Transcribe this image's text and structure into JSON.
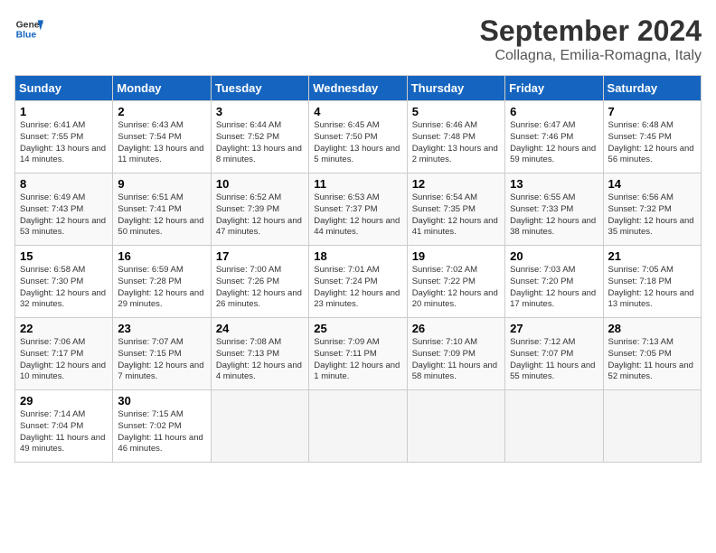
{
  "header": {
    "logo_general": "General",
    "logo_blue": "Blue",
    "month": "September 2024",
    "location": "Collagna, Emilia-Romagna, Italy"
  },
  "weekdays": [
    "Sunday",
    "Monday",
    "Tuesday",
    "Wednesday",
    "Thursday",
    "Friday",
    "Saturday"
  ],
  "weeks": [
    [
      {
        "day": "1",
        "sunrise": "6:41 AM",
        "sunset": "7:55 PM",
        "daylight": "13 hours and 14 minutes."
      },
      {
        "day": "2",
        "sunrise": "6:43 AM",
        "sunset": "7:54 PM",
        "daylight": "13 hours and 11 minutes."
      },
      {
        "day": "3",
        "sunrise": "6:44 AM",
        "sunset": "7:52 PM",
        "daylight": "13 hours and 8 minutes."
      },
      {
        "day": "4",
        "sunrise": "6:45 AM",
        "sunset": "7:50 PM",
        "daylight": "13 hours and 5 minutes."
      },
      {
        "day": "5",
        "sunrise": "6:46 AM",
        "sunset": "7:48 PM",
        "daylight": "13 hours and 2 minutes."
      },
      {
        "day": "6",
        "sunrise": "6:47 AM",
        "sunset": "7:46 PM",
        "daylight": "12 hours and 59 minutes."
      },
      {
        "day": "7",
        "sunrise": "6:48 AM",
        "sunset": "7:45 PM",
        "daylight": "12 hours and 56 minutes."
      }
    ],
    [
      {
        "day": "8",
        "sunrise": "6:49 AM",
        "sunset": "7:43 PM",
        "daylight": "12 hours and 53 minutes."
      },
      {
        "day": "9",
        "sunrise": "6:51 AM",
        "sunset": "7:41 PM",
        "daylight": "12 hours and 50 minutes."
      },
      {
        "day": "10",
        "sunrise": "6:52 AM",
        "sunset": "7:39 PM",
        "daylight": "12 hours and 47 minutes."
      },
      {
        "day": "11",
        "sunrise": "6:53 AM",
        "sunset": "7:37 PM",
        "daylight": "12 hours and 44 minutes."
      },
      {
        "day": "12",
        "sunrise": "6:54 AM",
        "sunset": "7:35 PM",
        "daylight": "12 hours and 41 minutes."
      },
      {
        "day": "13",
        "sunrise": "6:55 AM",
        "sunset": "7:33 PM",
        "daylight": "12 hours and 38 minutes."
      },
      {
        "day": "14",
        "sunrise": "6:56 AM",
        "sunset": "7:32 PM",
        "daylight": "12 hours and 35 minutes."
      }
    ],
    [
      {
        "day": "15",
        "sunrise": "6:58 AM",
        "sunset": "7:30 PM",
        "daylight": "12 hours and 32 minutes."
      },
      {
        "day": "16",
        "sunrise": "6:59 AM",
        "sunset": "7:28 PM",
        "daylight": "12 hours and 29 minutes."
      },
      {
        "day": "17",
        "sunrise": "7:00 AM",
        "sunset": "7:26 PM",
        "daylight": "12 hours and 26 minutes."
      },
      {
        "day": "18",
        "sunrise": "7:01 AM",
        "sunset": "7:24 PM",
        "daylight": "12 hours and 23 minutes."
      },
      {
        "day": "19",
        "sunrise": "7:02 AM",
        "sunset": "7:22 PM",
        "daylight": "12 hours and 20 minutes."
      },
      {
        "day": "20",
        "sunrise": "7:03 AM",
        "sunset": "7:20 PM",
        "daylight": "12 hours and 17 minutes."
      },
      {
        "day": "21",
        "sunrise": "7:05 AM",
        "sunset": "7:18 PM",
        "daylight": "12 hours and 13 minutes."
      }
    ],
    [
      {
        "day": "22",
        "sunrise": "7:06 AM",
        "sunset": "7:17 PM",
        "daylight": "12 hours and 10 minutes."
      },
      {
        "day": "23",
        "sunrise": "7:07 AM",
        "sunset": "7:15 PM",
        "daylight": "12 hours and 7 minutes."
      },
      {
        "day": "24",
        "sunrise": "7:08 AM",
        "sunset": "7:13 PM",
        "daylight": "12 hours and 4 minutes."
      },
      {
        "day": "25",
        "sunrise": "7:09 AM",
        "sunset": "7:11 PM",
        "daylight": "12 hours and 1 minute."
      },
      {
        "day": "26",
        "sunrise": "7:10 AM",
        "sunset": "7:09 PM",
        "daylight": "11 hours and 58 minutes."
      },
      {
        "day": "27",
        "sunrise": "7:12 AM",
        "sunset": "7:07 PM",
        "daylight": "11 hours and 55 minutes."
      },
      {
        "day": "28",
        "sunrise": "7:13 AM",
        "sunset": "7:05 PM",
        "daylight": "11 hours and 52 minutes."
      }
    ],
    [
      {
        "day": "29",
        "sunrise": "7:14 AM",
        "sunset": "7:04 PM",
        "daylight": "11 hours and 49 minutes."
      },
      {
        "day": "30",
        "sunrise": "7:15 AM",
        "sunset": "7:02 PM",
        "daylight": "11 hours and 46 minutes."
      },
      null,
      null,
      null,
      null,
      null
    ]
  ]
}
